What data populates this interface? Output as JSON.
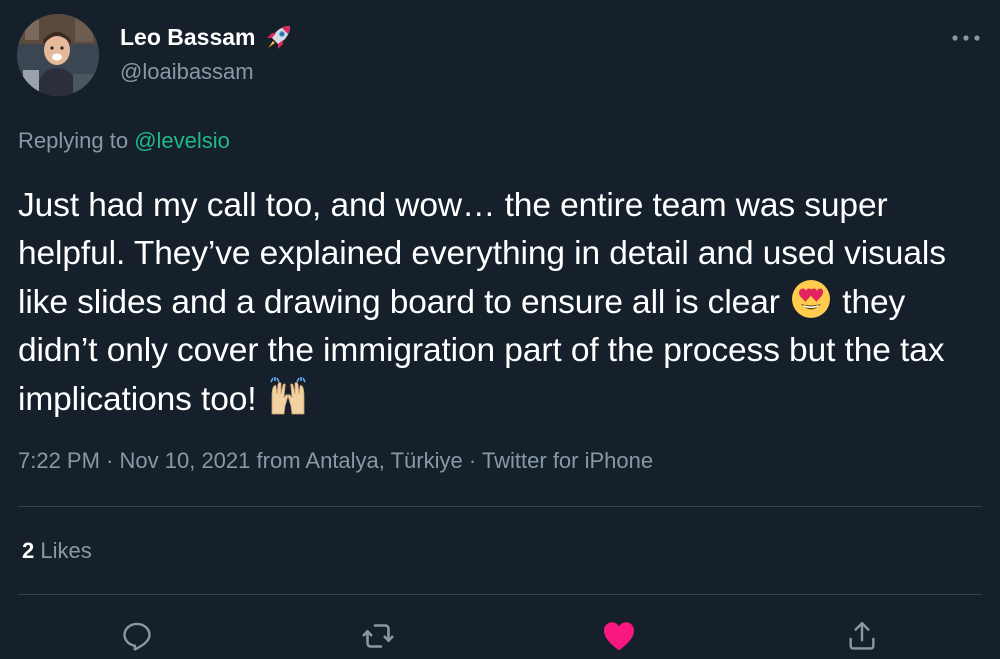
{
  "author": {
    "display_name": "Leo Bassam",
    "handle": "@loaibassam",
    "badge_emoji": "rocket-emoji",
    "avatar": "profile-photo"
  },
  "reply": {
    "prefix": "Replying to",
    "to": "@levelsio"
  },
  "tweet": {
    "text_part_1": "Just had my call too, and wow… the entire team was super helpful. They’ve explained everything in detail and used visuals like slides and a drawing board to ensure all is clear",
    "emoji_1": "heart-eyes-emoji",
    "text_part_2": "they didn’t only cover the immigration part of the process but the tax implications too!",
    "emoji_2": "raising-hands-emoji"
  },
  "meta": {
    "time": "7:22 PM",
    "date": "Nov 10, 2021",
    "location": "from Antalya, Türkiye",
    "source": "Twitter for iPhone",
    "separator": "·"
  },
  "stats": {
    "likes_count": "2",
    "likes_label": "Likes"
  },
  "actions": [
    {
      "name": "reply",
      "icon": "comment-icon"
    },
    {
      "name": "retweet",
      "icon": "retweet-icon"
    },
    {
      "name": "like",
      "icon": "heart-icon",
      "active": true
    },
    {
      "name": "share",
      "icon": "share-icon"
    }
  ],
  "colors": {
    "background": "#15202b",
    "text": "#ffffff",
    "secondary_text": "#8899a6",
    "link": "#1eb88a",
    "like_active": "#f91880",
    "divider": "#38444d"
  }
}
